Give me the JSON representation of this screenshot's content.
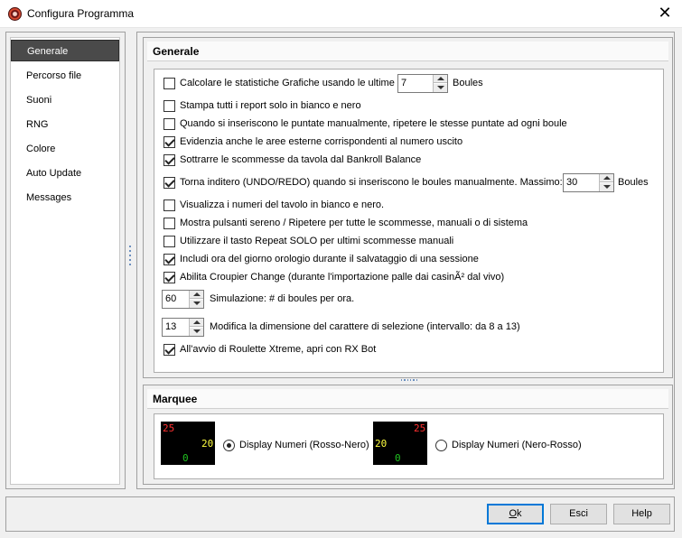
{
  "window": {
    "title": "Configura Programma",
    "close_glyph": "✕"
  },
  "sidebar": {
    "items": [
      {
        "label": "Generale",
        "active": true
      },
      {
        "label": "Percorso file"
      },
      {
        "label": "Suoni"
      },
      {
        "label": "RNG"
      },
      {
        "label": "Colore"
      },
      {
        "label": "Auto Update"
      },
      {
        "label": "Messages"
      }
    ]
  },
  "general": {
    "header": "Generale",
    "options": {
      "stats_label": "Calcolare le statistiche Grafiche usando le ultime",
      "stats_value": "7",
      "stats_unit": "Boules",
      "bw_reports": "Stampa tutti i report solo in bianco e nero",
      "repeat_bets": "Quando si inseriscono le puntate manualmente, ripetere le stesse puntate ad ogni boule",
      "highlight_outside": "Evidenzia anche le aree esterne corrispondenti al numero uscito",
      "subtract_bankroll": "Sottrarre le scommesse da tavola dal Bankroll Balance",
      "undo_label": "Torna inditero (UNDO/REDO) quando si inseriscono le boules manualmente.  Massimo:",
      "undo_value": "30",
      "undo_unit": "Boules",
      "bw_table": "Visualizza i numeri del tavolo in bianco e nero.",
      "show_buttons": "Mostra pulsanti sereno / Ripetere per tutte le scommesse, manuali o di sistema",
      "repeat_solo": "Utilizzare il tasto Repeat SOLO per ultimi scommesse manuali",
      "include_time": "Includi ora del giorno orologio durante il salvataggio di una sessione",
      "croupier_change": "Abilita Croupier Change (durante l'importazione palle dai casinÃ² dal vivo)",
      "sim_value": "60",
      "sim_label": "Simulazione: # di boules per ora.",
      "font_value": "13",
      "font_label": "Modifica la dimensione del carattere di selezione (intervallo: da 8 a 13)",
      "autostart": "All'avvio di Roulette Xtreme, apri con RX Bot"
    },
    "checked": {
      "stats": false,
      "bw_reports": false,
      "repeat_bets": false,
      "highlight_outside": true,
      "subtract_bankroll": true,
      "undo": true,
      "bw_table": false,
      "show_buttons": false,
      "repeat_solo": false,
      "include_time": true,
      "croupier_change": true,
      "autostart": true
    }
  },
  "marquee": {
    "header": "Marquee",
    "option1": {
      "label": "Display Numeri (Rosso-Nero)",
      "selected": true,
      "red": "25",
      "black": "20",
      "green": "0"
    },
    "option2": {
      "label": "Display Numeri (Nero-Rosso)",
      "selected": false,
      "red": "25",
      "black": "20",
      "green": "0"
    },
    "colors": {
      "red": "#ff3030",
      "yellow": "#ffff40",
      "green": "#20c020"
    }
  },
  "buttons": {
    "ok_underlined": "O",
    "ok_rest": "k",
    "cancel": "Esci",
    "help": "Help"
  }
}
